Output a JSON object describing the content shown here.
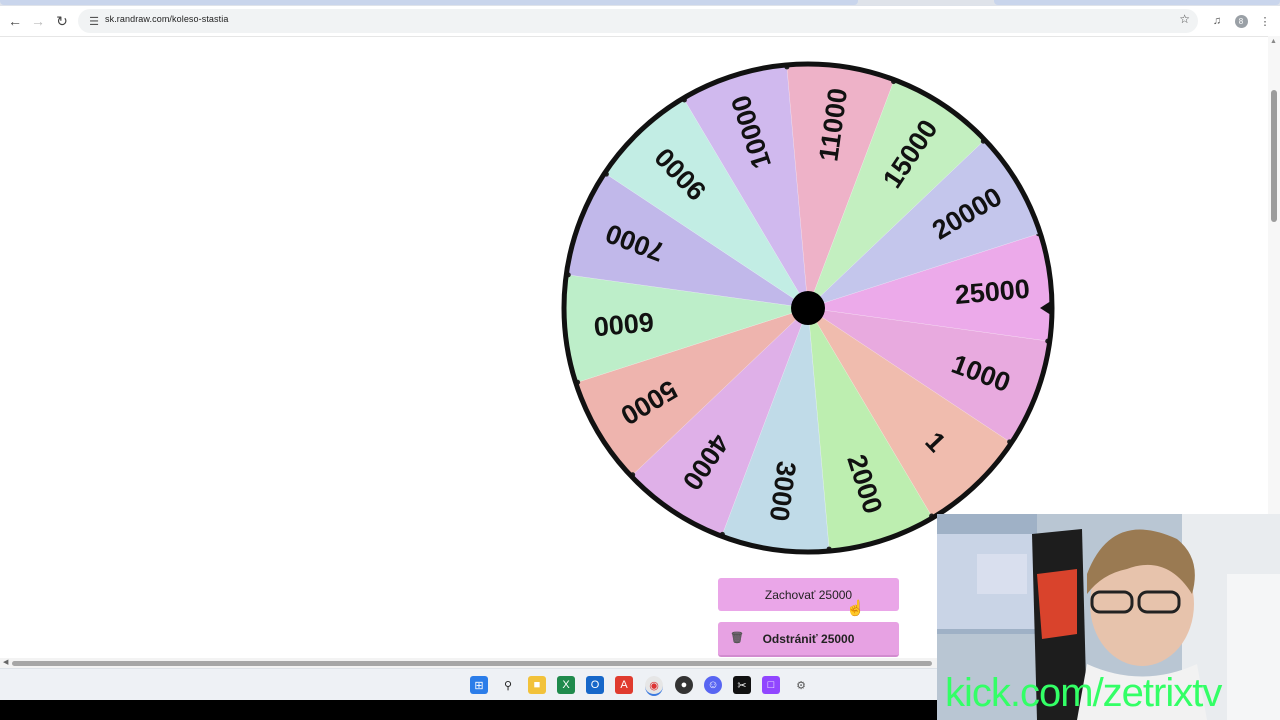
{
  "browser": {
    "url": "sk.randraw.com/koleso-stastia",
    "profile_initial": "8"
  },
  "wheel": {
    "segments": [
      {
        "label": "25000",
        "color": "#ecaaea"
      },
      {
        "label": "1000",
        "color": "#e8aadf"
      },
      {
        "label": "1",
        "color": "#f0bcae"
      },
      {
        "label": "2000",
        "color": "#bdeeb0"
      },
      {
        "label": "3000",
        "color": "#c0dbe8"
      },
      {
        "label": "4000",
        "color": "#dfb0e8"
      },
      {
        "label": "5000",
        "color": "#eeb4ae"
      },
      {
        "label": "6000",
        "color": "#bdeec9"
      },
      {
        "label": "7000",
        "color": "#c1b8ea"
      },
      {
        "label": "9000",
        "color": "#c2ede4"
      },
      {
        "label": "10000",
        "color": "#d0b9ee"
      },
      {
        "label": "11000",
        "color": "#eeb2c8"
      },
      {
        "label": "15000",
        "color": "#c3efc0"
      },
      {
        "label": "20000",
        "color": "#c4c6ec"
      }
    ]
  },
  "actions": {
    "keep_label": "Zachovať 25000",
    "remove_label": "Odstrániť 25000"
  },
  "overlay": {
    "channel_text": "kick.com/zetrixtv"
  },
  "taskbar": {
    "apps": [
      "start-icon",
      "search-icon",
      "file-explorer-icon",
      "excel-icon",
      "outlook-icon",
      "acrobat-icon",
      "chrome-icon",
      "app-icon",
      "discord-icon",
      "capcut-icon",
      "twitch-icon",
      "settings-icon"
    ]
  },
  "colors": {
    "accent_button": "#e8a5e6",
    "wheel_border": "#111111",
    "cam_text": "#33ff66"
  }
}
